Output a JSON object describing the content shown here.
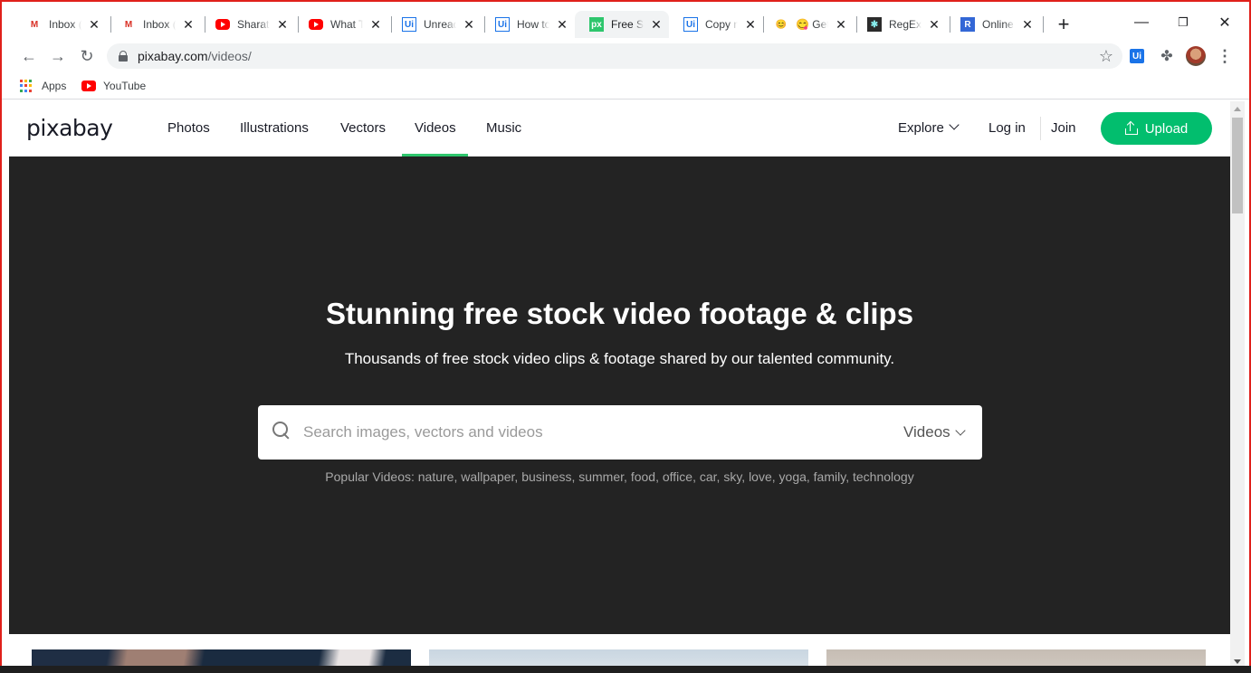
{
  "browser": {
    "tabs": [
      {
        "title": "Inbox (",
        "favicon": "gmail-icon"
      },
      {
        "title": "Inbox (",
        "favicon": "gmail-icon"
      },
      {
        "title": "Sharath",
        "favicon": "youtube-icon"
      },
      {
        "title": "What T",
        "favicon": "youtube-icon"
      },
      {
        "title": "Unread",
        "favicon": "uipath-icon"
      },
      {
        "title": "How to",
        "favicon": "uipath-icon"
      },
      {
        "title": "Free St",
        "favicon": "pixabay-icon"
      },
      {
        "title": "Copy n",
        "favicon": "uipath-icon"
      },
      {
        "title": "Get",
        "favicon": "emoji-icon"
      },
      {
        "title": "RegExr",
        "favicon": "regexr-icon"
      },
      {
        "title": "Online",
        "favicon": "r-icon"
      }
    ],
    "active_tab_index": 6,
    "url_host": "pixabay.com",
    "url_path": "/videos/",
    "favicon_text": {
      "uipath": "Ui",
      "pixabay": "px",
      "r": "R",
      "emoji": "😋",
      "regexr": "✱"
    },
    "bookmarks": [
      {
        "label": "Apps",
        "icon": "apps-grid-icon"
      },
      {
        "label": "YouTube",
        "icon": "youtube-icon"
      }
    ],
    "extension_ui_label": "Ui"
  },
  "site": {
    "logo": "pixabay",
    "nav": [
      "Photos",
      "Illustrations",
      "Vectors",
      "Videos",
      "Music"
    ],
    "active_nav": "Videos",
    "explore_label": "Explore",
    "login_label": "Log in",
    "join_label": "Join",
    "upload_label": "Upload",
    "accent_color": "#02be6e"
  },
  "hero": {
    "title": "Stunning free stock video footage & clips",
    "subtitle": "Thousands of free stock video clips & footage shared by our talented community.",
    "search_placeholder": "Search images, vectors and videos",
    "search_type": "Videos",
    "popular_label": "Popular Videos:",
    "popular_tags": [
      "nature",
      "wallpaper",
      "business",
      "summer",
      "food",
      "office",
      "car",
      "sky",
      "love",
      "yoga",
      "family",
      "technology"
    ],
    "background_color": "#232323"
  }
}
